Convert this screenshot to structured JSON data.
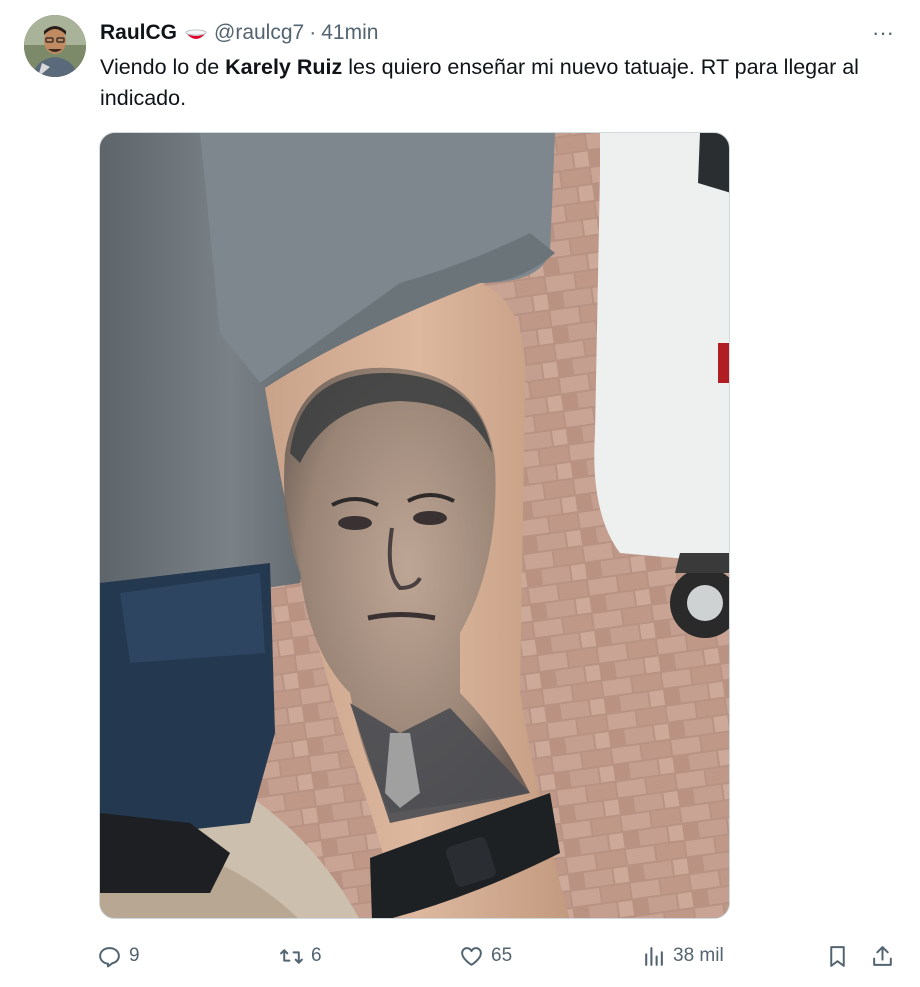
{
  "author": {
    "display_name": "RaulCG",
    "handle": "@raulcg7",
    "separator": "·",
    "time": "41min",
    "flag_icon": "bowl-flag-icon",
    "avatar_icon": "avatar"
  },
  "tweet": {
    "text_before": "Viendo lo de ",
    "text_bold": "Karely Ruiz",
    "text_after": " les quiero enseñar mi nuevo tatuaje. RT para llegar al indicado."
  },
  "more_icon": "more-horizontal-icon",
  "more_label": "···",
  "actions": {
    "replies": "9",
    "retweets": "6",
    "likes": "65",
    "views": "38 mil"
  },
  "colors": {
    "text": "#0f1419",
    "secondary": "#536471",
    "border": "#cfd9de"
  }
}
